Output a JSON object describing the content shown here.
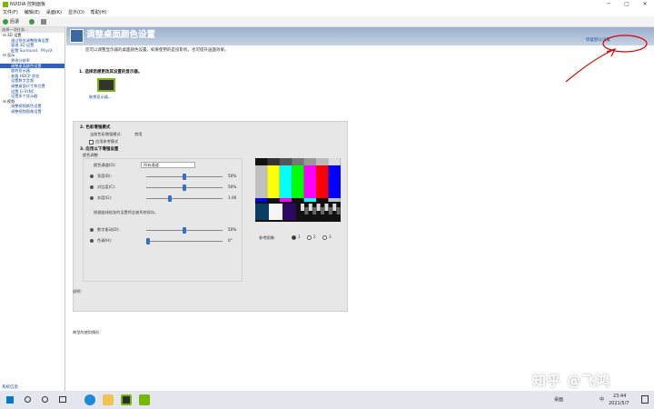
{
  "window": {
    "title": "NVIDIA 控制面板",
    "minimize": "─",
    "maximize": "▢",
    "close": "✕"
  },
  "menu": [
    "文件(F)",
    "编辑(E)",
    "桌面(K)",
    "显示(D)",
    "帮助(H)"
  ],
  "toolbar": {
    "back": "后退",
    "forward": ""
  },
  "sidebar": {
    "header": "选择一项任务...",
    "groups": [
      {
        "label": "3D 设置",
        "items": [
          "通过预览调整图像设置",
          "管理 3D 设置",
          "配置 Surround、PhysX"
        ]
      },
      {
        "label": "显示",
        "items": [
          "更改分辨率",
          "调整桌面颜色设置",
          "旋转显示器",
          "查看 HDCP 状态",
          "设置数字音频",
          "调整桌面尺寸和位置",
          "设置 G-SYNC",
          "设置多个显示器"
        ]
      },
      {
        "label": "视频",
        "items": [
          "调整视频颜色设置",
          "调整视频图像设置"
        ]
      }
    ],
    "selected": "调整桌面颜色设置",
    "system_info": "系统信息"
  },
  "page": {
    "title": "调整桌面颜色设置",
    "restore": "恢复默认设置",
    "description": "您可以调整显示器的桌面颜色设置。如果使用的是投影机，也可提升画面效果。",
    "step1": "1. 选择您想更改其设置的显示器。",
    "monitor_label": "联想显示器...",
    "step2": "2. 色彩增强模式",
    "current_mode_label": "当前色彩增强模式:",
    "current_mode_value": "禁用",
    "reference_mode": "应用参考模式",
    "step3": "3. 应用以下增强设置",
    "color_adjust": "颜色调整",
    "channel_label": "颜色通道(O):",
    "channel_value": "所有通道",
    "sliders": [
      {
        "label": "亮度(B):",
        "value": "50%",
        "level": 0.5
      },
      {
        "label": "对比度(C):",
        "value": "50%",
        "level": 0.5
      },
      {
        "label": "灰度(G):",
        "value": "1.00",
        "level": 0.3
      }
    ],
    "note": "根据曲线校准的设置将会被系统保存。",
    "sliders2": [
      {
        "label": "数字振动(D):",
        "value": "50%",
        "level": 0.5
      },
      {
        "label": "色调(H):",
        "value": "0°",
        "level": 0.0
      }
    ],
    "ref_image_label": "参考图像:",
    "ref_options": [
      "1",
      "2",
      "3"
    ],
    "desc_label": "说明:",
    "usage_label": "典型的使用情形:"
  },
  "watermark": "知乎 @飞鸿",
  "taskbar": {
    "search_icon": "search-icon",
    "time": "23:44",
    "date": "2021/5/7",
    "lang": "桌面",
    "ime": "中"
  }
}
